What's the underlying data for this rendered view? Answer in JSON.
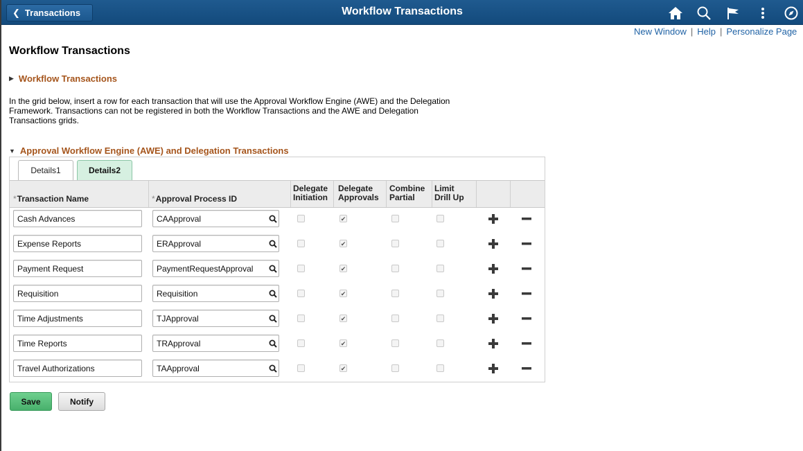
{
  "banner": {
    "back_label": "Transactions",
    "title": "Workflow Transactions",
    "icons": [
      "home-icon",
      "search-icon",
      "flag-icon",
      "more-icon",
      "navbar-compass-icon"
    ]
  },
  "toplinks": {
    "new_window": "New Window",
    "help": "Help",
    "personalize": "Personalize Page",
    "separator": "|"
  },
  "page": {
    "title": "Workflow Transactions",
    "section1": "Workflow Transactions",
    "description": "In the grid below, insert a row for each transaction that will use the Approval Workflow Engine (AWE) and the Delegation Framework. Transactions can not be registered in both the Workflow Transactions and the AWE and Delegation Transactions grids.",
    "section2": "Approval Workflow Engine (AWE) and Delegation Transactions"
  },
  "grid": {
    "tabs": [
      "Details1",
      "Details2"
    ],
    "active_tab": "Details2",
    "columns": {
      "transaction_name": "Transaction Name",
      "approval_process_id": "Approval Process ID",
      "delegate_initiation": [
        "Delegate",
        "Initiation"
      ],
      "delegate_approvals": [
        "Delegate",
        "Approvals"
      ],
      "combine_partial": [
        "Combine",
        "Partial"
      ],
      "limit_drill_up": [
        "Limit",
        "Drill Up"
      ],
      "required_marker": "*"
    },
    "rows": [
      {
        "name": "Cash Advances",
        "process_id": "CAApproval",
        "delegate_initiation": false,
        "delegate_approvals": true,
        "combine_partial": false,
        "limit_drill_up": false
      },
      {
        "name": "Expense Reports",
        "process_id": "ERApproval",
        "delegate_initiation": false,
        "delegate_approvals": true,
        "combine_partial": false,
        "limit_drill_up": false
      },
      {
        "name": "Payment Request",
        "process_id": "PaymentRequestApproval",
        "delegate_initiation": false,
        "delegate_approvals": true,
        "combine_partial": false,
        "limit_drill_up": false
      },
      {
        "name": "Requisition",
        "process_id": "Requisition",
        "delegate_initiation": false,
        "delegate_approvals": true,
        "combine_partial": false,
        "limit_drill_up": false
      },
      {
        "name": "Time Adjustments",
        "process_id": "TJApproval",
        "delegate_initiation": false,
        "delegate_approvals": true,
        "combine_partial": false,
        "limit_drill_up": false
      },
      {
        "name": "Time Reports",
        "process_id": "TRApproval",
        "delegate_initiation": false,
        "delegate_approvals": true,
        "combine_partial": false,
        "limit_drill_up": false
      },
      {
        "name": "Travel Authorizations",
        "process_id": "TAApproval",
        "delegate_initiation": false,
        "delegate_approvals": true,
        "combine_partial": false,
        "limit_drill_up": false
      }
    ]
  },
  "buttons": {
    "save": "Save",
    "notify": "Notify"
  },
  "colors": {
    "banner": "#1a5289",
    "section_header": "#a5551c",
    "link": "#1f62a5",
    "save_button": "#5cc07c",
    "active_tab": "#d6f0e1"
  }
}
